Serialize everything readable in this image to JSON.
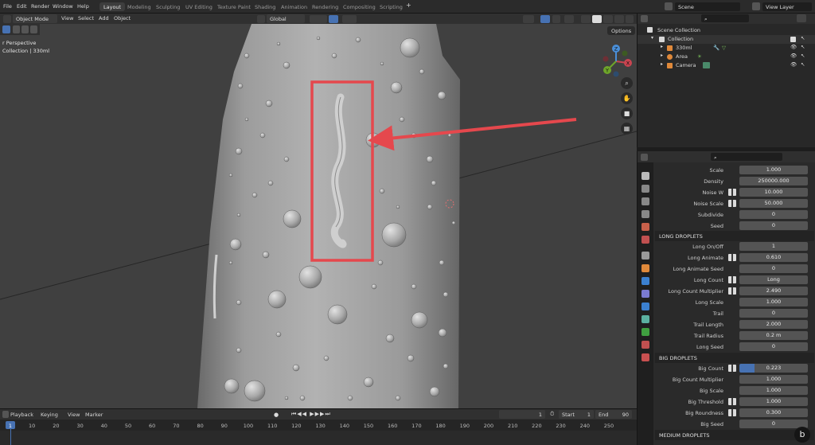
{
  "menu": [
    "File",
    "Edit",
    "Render",
    "Window",
    "Help"
  ],
  "workspaces": [
    "Layout",
    "Modeling",
    "Sculpting",
    "UV Editing",
    "Texture Paint",
    "Shading",
    "Animation",
    "Rendering",
    "Compositing",
    "Scripting"
  ],
  "active_workspace": "Layout",
  "scene_field": "Scene",
  "view_layer_field": "View Layer",
  "viewport_header": {
    "mode": "Object Mode",
    "menus": [
      "View",
      "Select",
      "Add",
      "Object"
    ],
    "transform_orientation": "Global",
    "options_label": "Options"
  },
  "viewport": {
    "perspective_text": "r Perspective",
    "collection_text": "Collection | 330ml",
    "gizmo_axes": [
      "X",
      "Y",
      "Z"
    ]
  },
  "annotation_color": "#e5484d",
  "outliner": {
    "root": "Scene Collection",
    "collection": "Collection",
    "items": [
      "330ml",
      "Area",
      "Camera"
    ]
  },
  "properties": {
    "rows_top": [
      {
        "label": "Scale",
        "value": "1.000",
        "key": false
      },
      {
        "label": "Density",
        "value": "250000.000",
        "key": false
      },
      {
        "label": "Noise W",
        "value": "10.000",
        "key": true
      },
      {
        "label": "Noise Scale",
        "value": "50.000",
        "key": true
      },
      {
        "label": "Subdivide",
        "value": "0",
        "key": false
      },
      {
        "label": "Seed",
        "value": "0",
        "key": false
      }
    ],
    "long_section": "LONG DROPLETS",
    "rows_long": [
      {
        "label": "Long On/Off",
        "value": "1",
        "key": false
      },
      {
        "label": "Long Animate",
        "value": "0.610",
        "key": true
      },
      {
        "label": "Long Animate Seed",
        "value": "0",
        "key": false
      },
      {
        "label": "Long Count",
        "value": "Long",
        "key": true
      },
      {
        "label": "Long Count Multiplier",
        "value": "2.490",
        "key": true
      },
      {
        "label": "Long Scale",
        "value": "1.000",
        "key": false
      },
      {
        "label": "Trail",
        "value": "0",
        "key": false
      },
      {
        "label": "Trail Length",
        "value": "2.000",
        "key": false
      },
      {
        "label": "Trail Radius",
        "value": "0.2 m",
        "key": false
      },
      {
        "label": "Long Seed",
        "value": "0",
        "key": false
      }
    ],
    "big_section": "BIG DROPLETS",
    "rows_big": [
      {
        "label": "Big Count",
        "value": "0.223",
        "key": true,
        "fill": 0.223
      },
      {
        "label": "Big Count Multiplier",
        "value": "1.000",
        "key": false
      },
      {
        "label": "Big Scale",
        "value": "1.000",
        "key": false
      },
      {
        "label": "Big Threshold",
        "value": "1.000",
        "key": true
      },
      {
        "label": "Big Roundness",
        "value": "0.300",
        "key": true
      },
      {
        "label": "Big Seed",
        "value": "0",
        "key": false
      }
    ],
    "medium_section": "MEDIUM DROPLETS"
  },
  "timeline": {
    "menus": [
      "Playback",
      "Keying",
      "View",
      "Marker"
    ],
    "current_frame": "1",
    "start_label": "Start",
    "start_value": "1",
    "end_label": "End",
    "end_value": "90",
    "ruler": [
      "1",
      "10",
      "20",
      "30",
      "40",
      "50",
      "60",
      "70",
      "80",
      "90",
      "100",
      "110",
      "120",
      "130",
      "140",
      "150",
      "160",
      "170",
      "180",
      "190",
      "200",
      "210",
      "220",
      "230",
      "240",
      "250"
    ]
  }
}
